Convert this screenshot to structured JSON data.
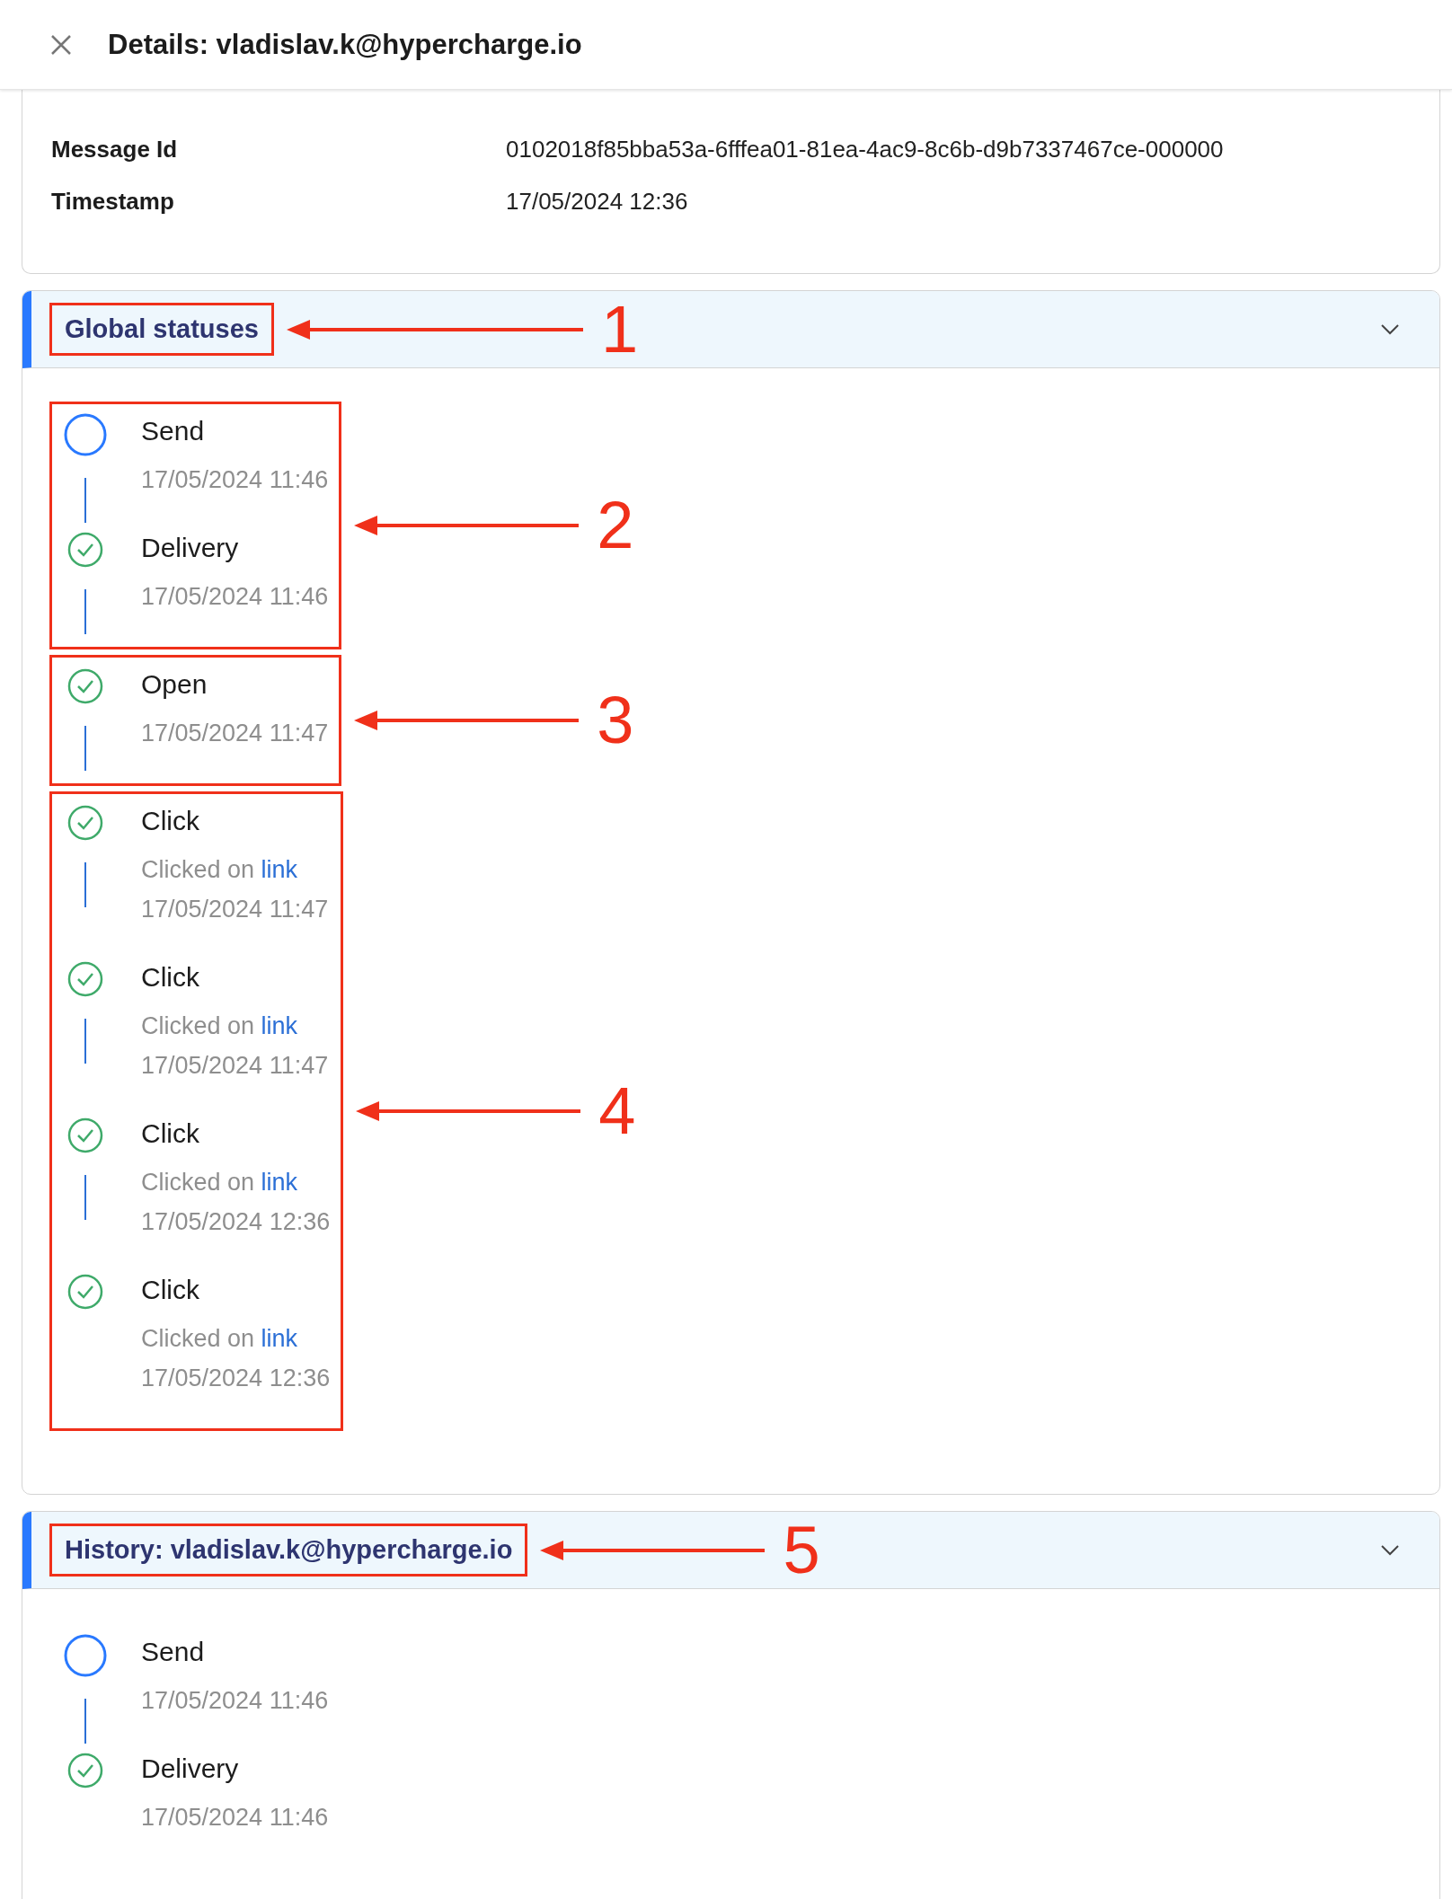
{
  "header": {
    "title": "Details: vladislav.k@hypercharge.io"
  },
  "details": [
    {
      "label": "Message Id",
      "value": "0102018f85bba53a-6fffea01-81ea-4ac9-8c6b-d9b7337467ce-000000"
    },
    {
      "label": "Timestamp",
      "value": "17/05/2024 12:36"
    }
  ],
  "panels": [
    {
      "title": "Global statuses",
      "expanded": true,
      "annotation": "1",
      "groups": [
        {
          "annotation": "2",
          "events": [
            {
              "kind": "pending",
              "title": "Send",
              "date": "17/05/2024 11:46"
            },
            {
              "kind": "complete",
              "title": "Delivery",
              "date": "17/05/2024 11:46"
            }
          ]
        },
        {
          "annotation": "3",
          "events": [
            {
              "kind": "complete",
              "title": "Open",
              "date": "17/05/2024 11:47"
            }
          ]
        },
        {
          "annotation": "4",
          "events": [
            {
              "kind": "complete",
              "title": "Click",
              "detail": {
                "text": "Clicked on",
                "link": "link"
              },
              "date": "17/05/2024 11:47"
            },
            {
              "kind": "complete",
              "title": "Click",
              "detail": {
                "text": "Clicked on",
                "link": "link"
              },
              "date": "17/05/2024 11:47"
            },
            {
              "kind": "complete",
              "title": "Click",
              "detail": {
                "text": "Clicked on",
                "link": "link"
              },
              "date": "17/05/2024 12:36"
            },
            {
              "kind": "complete",
              "title": "Click",
              "detail": {
                "text": "Clicked on",
                "link": "link"
              },
              "date": "17/05/2024 12:36"
            }
          ]
        }
      ]
    },
    {
      "title": "History: vladislav.k@hypercharge.io",
      "expanded": true,
      "annotation": "5",
      "groups": [
        {
          "events": [
            {
              "kind": "pending",
              "title": "Send",
              "date": "17/05/2024 11:46"
            },
            {
              "kind": "complete",
              "title": "Delivery",
              "date": "17/05/2024 11:46"
            }
          ]
        }
      ]
    }
  ]
}
